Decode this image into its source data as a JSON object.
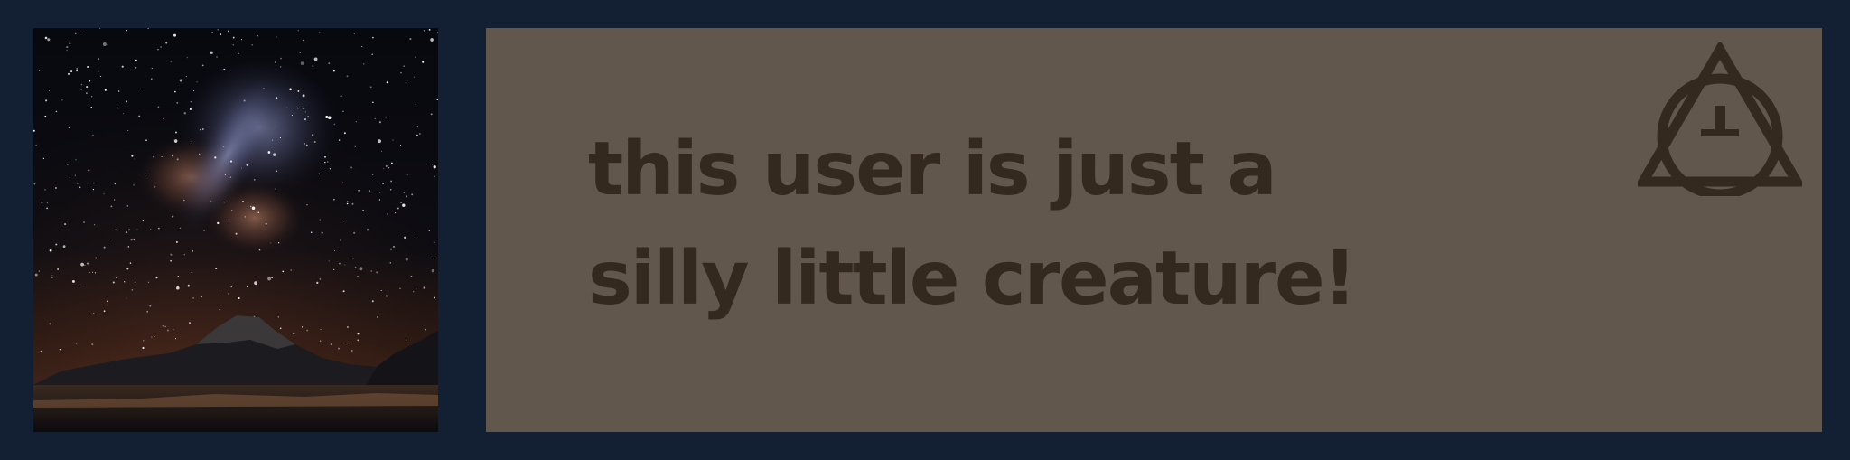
{
  "banner": {
    "background_color": "#131f33",
    "panel_color": "#62574c",
    "text_color": "#34291f",
    "photo": {
      "subject": "night sky with milky way over mountains and lake"
    },
    "tagline": {
      "line1": "this user is just a",
      "line2": "silly little creature!"
    },
    "symbol": {
      "icon": "therian-theta-icon",
      "glyph": "Θ"
    }
  }
}
